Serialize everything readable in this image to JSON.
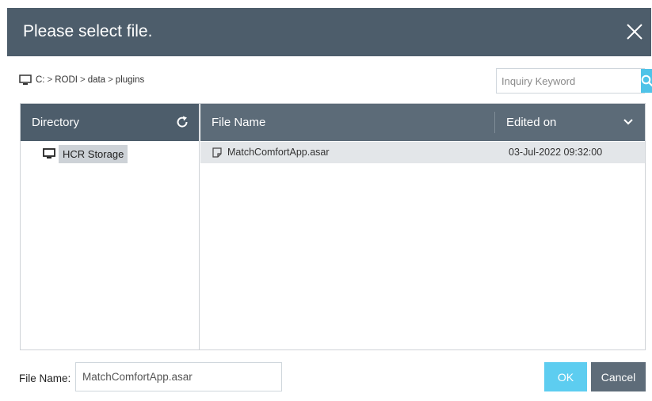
{
  "dialog": {
    "title": "Please select file.",
    "close_icon": "close-icon"
  },
  "breadcrumb": {
    "icon": "computer-icon",
    "segments": [
      "C:",
      "RODI",
      "data",
      "plugins"
    ],
    "separator": ">"
  },
  "search": {
    "placeholder": "Inquiry Keyword",
    "value": "",
    "icon": "search-icon"
  },
  "directory": {
    "header": "Directory",
    "refresh_icon": "refresh-icon",
    "items": [
      {
        "label": "HCR Storage",
        "icon": "computer-icon",
        "selected": true
      }
    ]
  },
  "files": {
    "columns": {
      "name": "File Name",
      "edited": "Edited on"
    },
    "sort_icon": "chevron-down-icon",
    "rows": [
      {
        "name": "MatchComfortApp.asar",
        "edited": "03-Jul-2022 09:32:00",
        "selected": true
      }
    ]
  },
  "footer": {
    "file_name_label": "File Name:",
    "file_name_value": "MatchComfortApp.asar",
    "ok_label": "OK",
    "cancel_label": "Cancel"
  },
  "colors": {
    "header_dark": "#4d5d6b",
    "header_file": "#5c6b78",
    "accent": "#5dcdf0",
    "search_button": "#4fc3e8",
    "cancel": "#5e6c79",
    "row_selected": "#e3e6e9"
  }
}
